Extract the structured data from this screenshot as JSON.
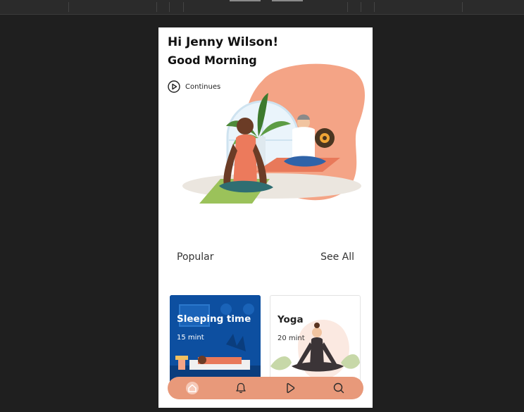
{
  "greeting": {
    "line1": "Hi Jenny Wilson!",
    "line2": "Good Morning"
  },
  "continue_label": "Continues",
  "popular": {
    "title": "Popular",
    "see_all": "See All"
  },
  "cards": [
    {
      "title": "Sleeping time",
      "duration": "15 mint"
    },
    {
      "title": "Yoga",
      "duration": "20 mint"
    }
  ],
  "nav": [
    "home-icon",
    "bell-icon",
    "play-icon",
    "search-icon"
  ],
  "colors": {
    "accent": "#e8997a",
    "blob": "#f4a486",
    "sleep_card": "#0d4fa0"
  }
}
